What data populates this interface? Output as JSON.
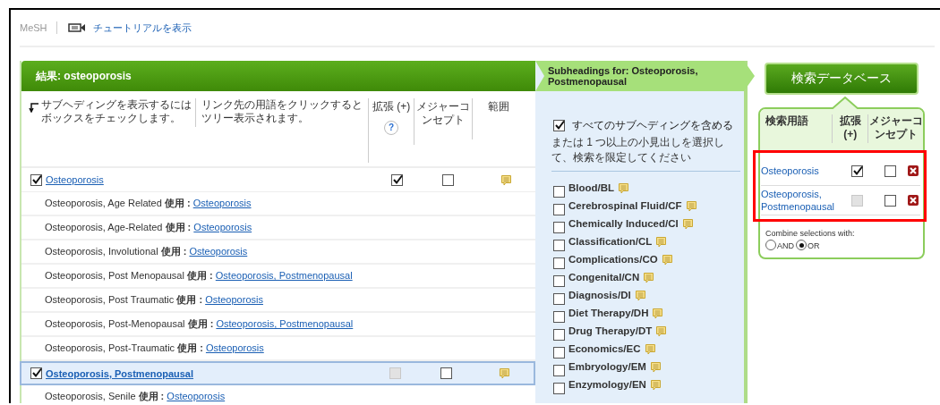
{
  "header": {
    "section": "MeSH",
    "tutorial_link": "チュートリアルを表示"
  },
  "results": {
    "title": "結果: osteoporosis",
    "hint_1": "サブヘディングを表示するにはボックスをチェックします。",
    "hint_2": "リンク先の用語をクリックするとツリー表示されます。",
    "columns": [
      "拡張 (+)",
      "メジャーコンセプト",
      "範囲"
    ],
    "help_mark": "?",
    "rows": [
      {
        "kind": "term",
        "term": "Osteoporosis",
        "checked": true,
        "selected": false,
        "explode_checked": true,
        "explode_disabled": false,
        "major_checked": false
      },
      {
        "kind": "synonym",
        "text": "Osteoporosis, Age Related **使用 :**",
        "link": "Osteoporosis"
      },
      {
        "kind": "synonym",
        "text": "Osteoporosis, Age-Related **使用 :**",
        "link": "Osteoporosis"
      },
      {
        "kind": "synonym",
        "text": "Osteoporosis, Involutional **使用 :**",
        "link": "Osteoporosis"
      },
      {
        "kind": "synonym",
        "text": "Osteoporosis, Post Menopausal **使用 :**",
        "link": "Osteoporosis, Postmenopausal"
      },
      {
        "kind": "synonym",
        "text": "Osteoporosis, Post Traumatic **使用 :**",
        "link": "Osteoporosis"
      },
      {
        "kind": "synonym",
        "text": "Osteoporosis, Post-Menopausal **使用 :**",
        "link": "Osteoporosis, Postmenopausal"
      },
      {
        "kind": "synonym",
        "text": "Osteoporosis, Post-Traumatic **使用 :**",
        "link": "Osteoporosis"
      },
      {
        "kind": "term",
        "term": "Osteoporosis, Postmenopausal",
        "checked": true,
        "selected": true,
        "explode_checked": false,
        "explode_disabled": true,
        "major_checked": false
      },
      {
        "kind": "synonym",
        "text": "Osteoporosis, Senile **使用 :**",
        "link": "Osteoporosis"
      }
    ]
  },
  "subheadings": {
    "title": "Subheadings for: Osteoporosis, Postmenopausal",
    "include_all": {
      "label": "すべてのサブヘディングを含める",
      "checked": true
    },
    "note": "または 1 つ以上の小見出しを選択して、検索を限定してください",
    "items": [
      {
        "label": "Blood/BL",
        "checked": false
      },
      {
        "label": "Cerebrospinal Fluid/CF",
        "checked": false
      },
      {
        "label": "Chemically Induced/CI",
        "checked": false
      },
      {
        "label": "Classification/CL",
        "checked": false
      },
      {
        "label": "Complications/CO",
        "checked": false
      },
      {
        "label": "Congenital/CN",
        "checked": false
      },
      {
        "label": "Diagnosis/DI",
        "checked": false
      },
      {
        "label": "Diet Therapy/DH",
        "checked": false
      },
      {
        "label": "Drug Therapy/DT",
        "checked": false
      },
      {
        "label": "Economics/EC",
        "checked": false
      },
      {
        "label": "Embryology/EM",
        "checked": false
      },
      {
        "label": "Enzymology/EN",
        "checked": false
      }
    ]
  },
  "search_builder": {
    "button": "検索データベース",
    "columns": [
      "検索用語",
      "拡張 (+)",
      "メジャーコンセプト"
    ],
    "terms": [
      {
        "term": "Osteoporosis",
        "explode_checked": true,
        "explode_disabled": false,
        "major_checked": false
      },
      {
        "term": "Osteoporosis, Postmenopausal",
        "explode_checked": false,
        "explode_disabled": true,
        "major_checked": false
      }
    ],
    "combine_label": "Combine selections with:",
    "options": [
      {
        "label": "AND",
        "selected": false
      },
      {
        "label": "OR",
        "selected": true
      }
    ]
  }
}
